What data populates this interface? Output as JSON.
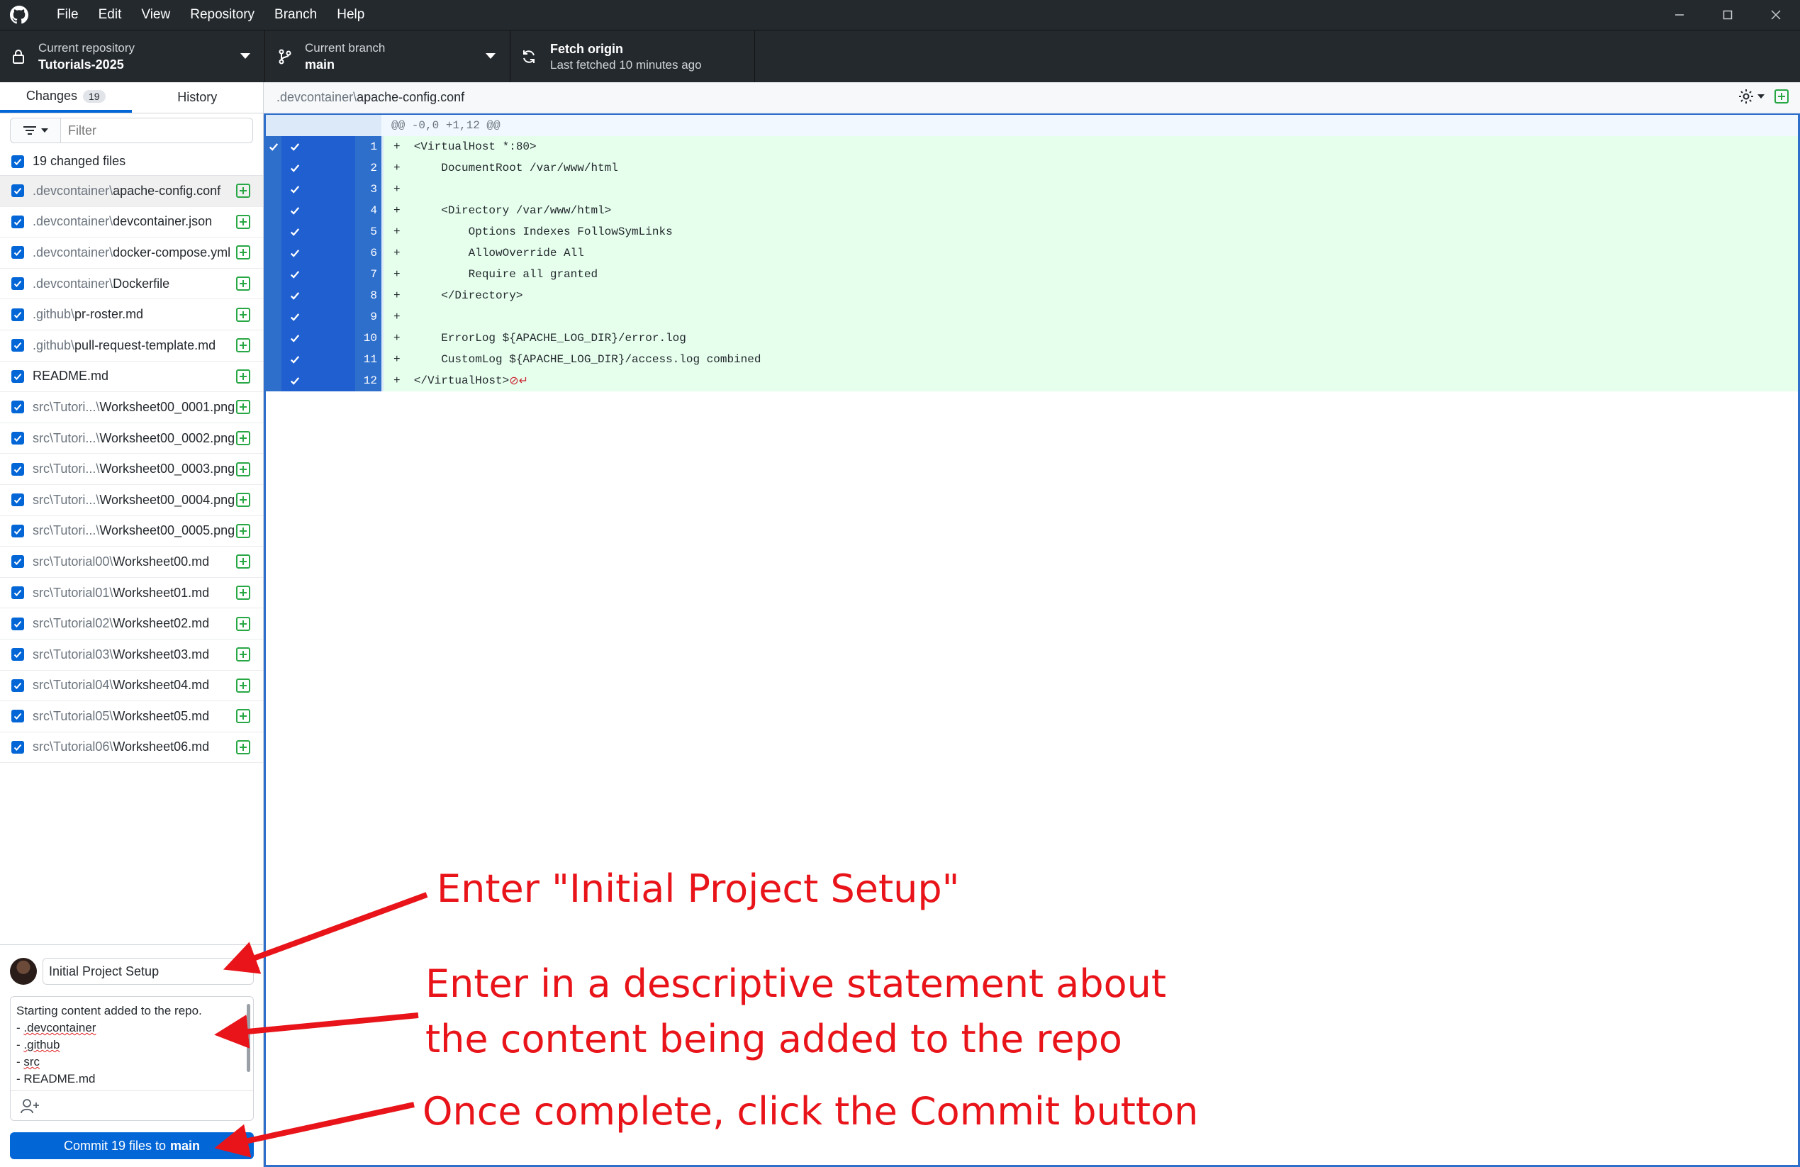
{
  "titlebar": {
    "menu": [
      "File",
      "Edit",
      "View",
      "Repository",
      "Branch",
      "Help"
    ]
  },
  "toolbar": {
    "repo": {
      "label": "Current repository",
      "value": "Tutorials-2025"
    },
    "branch": {
      "label": "Current branch",
      "value": "main"
    },
    "fetch": {
      "label": "Fetch origin",
      "value": "Last fetched 10 minutes ago"
    }
  },
  "sidebar": {
    "tabs": {
      "changes": "Changes",
      "changes_count": "19",
      "history": "History"
    },
    "filter_placeholder": "Filter",
    "all_label": "19 changed files",
    "files": [
      {
        "dir": ".devcontainer\\",
        "name": "apache-config.conf"
      },
      {
        "dir": ".devcontainer\\",
        "name": "devcontainer.json"
      },
      {
        "dir": ".devcontainer\\",
        "name": "docker-compose.yml"
      },
      {
        "dir": ".devcontainer\\",
        "name": "Dockerfile"
      },
      {
        "dir": ".github\\",
        "name": "pr-roster.md"
      },
      {
        "dir": ".github\\",
        "name": "pull-request-template.md"
      },
      {
        "dir": "",
        "name": "README.md"
      },
      {
        "dir": "src\\Tutori...\\",
        "name": "Worksheet00_0001.png"
      },
      {
        "dir": "src\\Tutori...\\",
        "name": "Worksheet00_0002.png"
      },
      {
        "dir": "src\\Tutori...\\",
        "name": "Worksheet00_0003.png"
      },
      {
        "dir": "src\\Tutori...\\",
        "name": "Worksheet00_0004.png"
      },
      {
        "dir": "src\\Tutori...\\",
        "name": "Worksheet00_0005.png"
      },
      {
        "dir": "src\\Tutorial00\\",
        "name": "Worksheet00.md"
      },
      {
        "dir": "src\\Tutorial01\\",
        "name": "Worksheet01.md"
      },
      {
        "dir": "src\\Tutorial02\\",
        "name": "Worksheet02.md"
      },
      {
        "dir": "src\\Tutorial03\\",
        "name": "Worksheet03.md"
      },
      {
        "dir": "src\\Tutorial04\\",
        "name": "Worksheet04.md"
      },
      {
        "dir": "src\\Tutorial05\\",
        "name": "Worksheet05.md"
      },
      {
        "dir": "src\\Tutorial06\\",
        "name": "Worksheet06.md"
      }
    ]
  },
  "commit": {
    "summary": "Initial Project Setup",
    "description": [
      "Starting content added to the repo.",
      "- .devcontainer",
      "- .github",
      "- src",
      "- README.md"
    ],
    "button_prefix": "Commit 19 files to",
    "button_branch": "main"
  },
  "diff": {
    "path_dir": ".devcontainer\\",
    "path_name": "apache-config.conf",
    "hunk": "@@ -0,0 +1,12 @@",
    "lines": [
      {
        "num": "1",
        "code": "+  <VirtualHost *:80>"
      },
      {
        "num": "2",
        "code": "+      DocumentRoot /var/www/html"
      },
      {
        "num": "3",
        "code": "+"
      },
      {
        "num": "4",
        "code": "+      <Directory /var/www/html>"
      },
      {
        "num": "5",
        "code": "+          Options Indexes FollowSymLinks"
      },
      {
        "num": "6",
        "code": "+          AllowOverride All"
      },
      {
        "num": "7",
        "code": "+          Require all granted"
      },
      {
        "num": "8",
        "code": "+      </Directory>"
      },
      {
        "num": "9",
        "code": "+"
      },
      {
        "num": "10",
        "code": "+      ErrorLog ${APACHE_LOG_DIR}/error.log"
      },
      {
        "num": "11",
        "code": "+      CustomLog ${APACHE_LOG_DIR}/access.log combined"
      },
      {
        "num": "12",
        "code": "+  </VirtualHost>"
      }
    ]
  },
  "annotations": {
    "summary_hint": "Enter \"Initial Project Setup\"",
    "description_hint_1": "Enter in a descriptive statement about",
    "description_hint_2": "the content being added to the repo",
    "commit_hint": "Once complete, click the Commit button"
  },
  "colors": {
    "chrome_dark": "#24292e",
    "accent_blue": "#0366d6",
    "added_green": "#e6ffed",
    "annotation_red": "#e8141a"
  }
}
